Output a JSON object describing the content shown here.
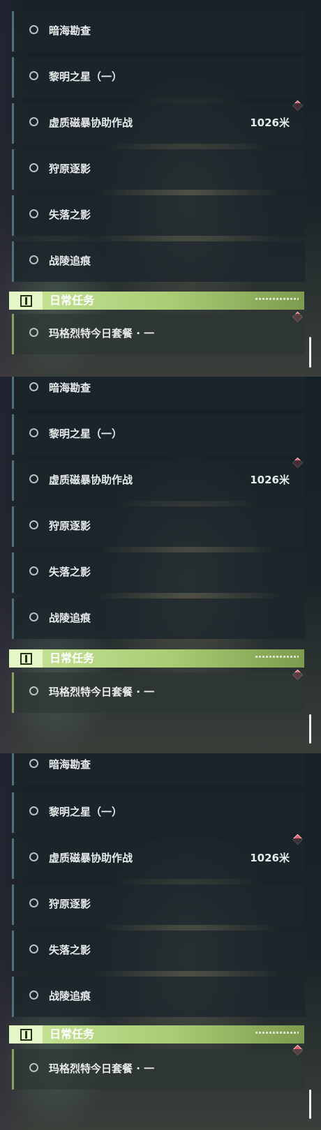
{
  "panels": [
    {
      "quests": [
        {
          "label": "暗海勘查",
          "distance": ""
        },
        {
          "label": "黎明之星（一）",
          "distance": ""
        },
        {
          "label": "虚质磁暴协助作战",
          "distance": "1026米"
        },
        {
          "label": "狩原逐影",
          "distance": ""
        },
        {
          "label": "失落之影",
          "distance": ""
        },
        {
          "label": "战陵追痕",
          "distance": ""
        }
      ],
      "daily_header": "日常任务",
      "daily_quest": "玛格烈特今日套餐 · 一"
    },
    {
      "quests": [
        {
          "label": "暗海勘查",
          "distance": ""
        },
        {
          "label": "黎明之星（一）",
          "distance": ""
        },
        {
          "label": "虚质磁暴协助作战",
          "distance": "1026米"
        },
        {
          "label": "狩原逐影",
          "distance": ""
        },
        {
          "label": "失落之影",
          "distance": ""
        },
        {
          "label": "战陵追痕",
          "distance": ""
        }
      ],
      "daily_header": "日常任务",
      "daily_quest": "玛格烈特今日套餐 · 一"
    },
    {
      "quests": [
        {
          "label": "暗海勘查",
          "distance": ""
        },
        {
          "label": "黎明之星（一）",
          "distance": ""
        },
        {
          "label": "虚质磁暴协助作战",
          "distance": "1026米"
        },
        {
          "label": "狩原逐影",
          "distance": ""
        },
        {
          "label": "失落之影",
          "distance": ""
        },
        {
          "label": "战陵追痕",
          "distance": ""
        }
      ],
      "daily_header": "日常任务",
      "daily_quest": "玛格烈特今日套餐 · 一"
    }
  ],
  "icons": {
    "quest_marker": "circle-ring-icon",
    "tracked_marker": "red-diamond-icon",
    "daily_marker": "exclamation-box-icon"
  },
  "colors": {
    "daily_accent": "#a9cc74",
    "tracked_marker": "#e05a6a",
    "quest_border": "#51707c"
  }
}
